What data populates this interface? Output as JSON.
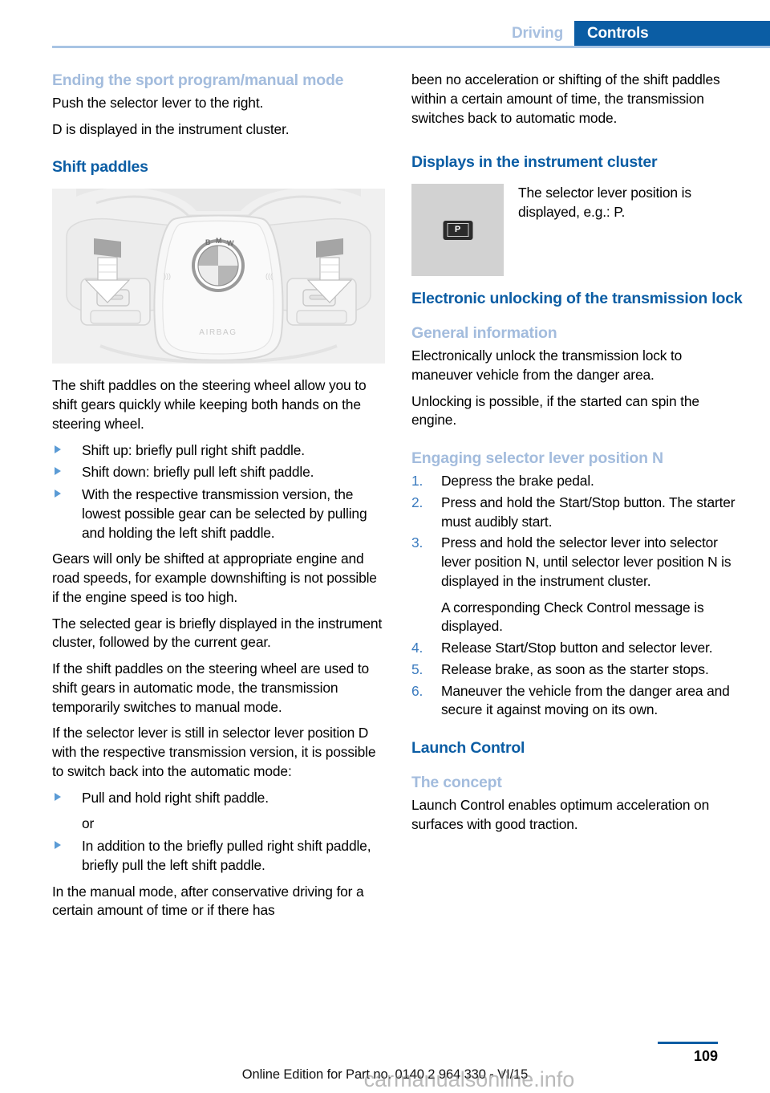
{
  "header": {
    "tab_inactive": "Driving",
    "tab_active": "Controls",
    "accent_blue": "#0b5da4",
    "muted_blue": "#a8c0e0"
  },
  "left_column": {
    "h3_ending": "Ending the sport program/manual mode",
    "p_push": "Push the selector lever to the right.",
    "p_d_displayed": "D is displayed in the instrument cluster.",
    "h2_shift_paddles": "Shift paddles",
    "figure": {
      "name": "steering-wheel-shift-paddles",
      "logo_letters": "BMW",
      "airbag_label": "AIRBAG"
    },
    "p_intro": "The shift paddles on the steering wheel allow you to shift gears quickly while keeping both hands on the steering wheel.",
    "bullets": [
      "Shift up: briefly pull right shift paddle.",
      "Shift down: briefly pull left shift paddle.",
      "With the respective transmission version, the lowest possible gear can be selected by pulling and holding the left shift paddle."
    ],
    "p_gears": "Gears will only be shifted at appropriate engine and road speeds, for example downshifting is not possible if the engine speed is too high.",
    "p_selected_gear": "The selected gear is briefly displayed in the instrument cluster, followed by the current gear.",
    "p_if_paddles": "If the shift paddles on the steering wheel are used to shift gears in automatic mode, the transmission temporarily switches to manual mode.",
    "p_if_lever": "If the selector lever is still in selector lever position D with the respective transmission version, it is possible to switch back into the automatic mode:",
    "bullets2_a": "Pull and hold right shift paddle.",
    "or_label": "or",
    "bullets2_b": "In addition to the briefly pulled right shift paddle, briefly pull the left shift paddle.",
    "p_manual_mode": "In the manual mode, after conservative driving for a certain amount of time or if there has"
  },
  "right_column": {
    "p_continued": "been no acceleration or shifting of the shift paddles within a certain amount of time, the transmission switches back to automatic mode.",
    "h2_displays": "Displays in the instrument cluster",
    "cluster": {
      "badge_letter": "P",
      "caption": "The selector lever position is displayed, e.g.: P."
    },
    "h2_electronic": "Electronic unlocking of the transmission lock",
    "h3_general": "General information",
    "p_electronically": "Electronically unlock the transmission lock to maneuver vehicle from the danger area.",
    "p_unlocking": "Unlocking is possible, if the started can spin the engine.",
    "h3_engaging": "Engaging selector lever position N",
    "steps": [
      {
        "num": "1.",
        "text": "Depress the brake pedal.",
        "cont": ""
      },
      {
        "num": "2.",
        "text": "Press and hold the Start/Stop button. The starter must audibly start.",
        "cont": ""
      },
      {
        "num": "3.",
        "text": "Press and hold the selector lever into selector lever position N, until selector lever position N is displayed in the instrument cluster.",
        "cont": "A corresponding Check Control message is displayed."
      },
      {
        "num": "4.",
        "text": "Release Start/Stop button and selector lever.",
        "cont": ""
      },
      {
        "num": "5.",
        "text": "Release brake, as soon as the starter stops.",
        "cont": ""
      },
      {
        "num": "6.",
        "text": "Maneuver the vehicle from the danger area and secure it against moving on its own.",
        "cont": ""
      }
    ],
    "h2_launch": "Launch Control",
    "h3_concept": "The concept",
    "p_launch": "Launch Control enables optimum acceleration on surfaces with good traction."
  },
  "footer": {
    "page_number": "109",
    "note": "Online Edition for Part no. 0140 2 964 330 - VI/15",
    "watermark": "carmanualsonline.info"
  }
}
